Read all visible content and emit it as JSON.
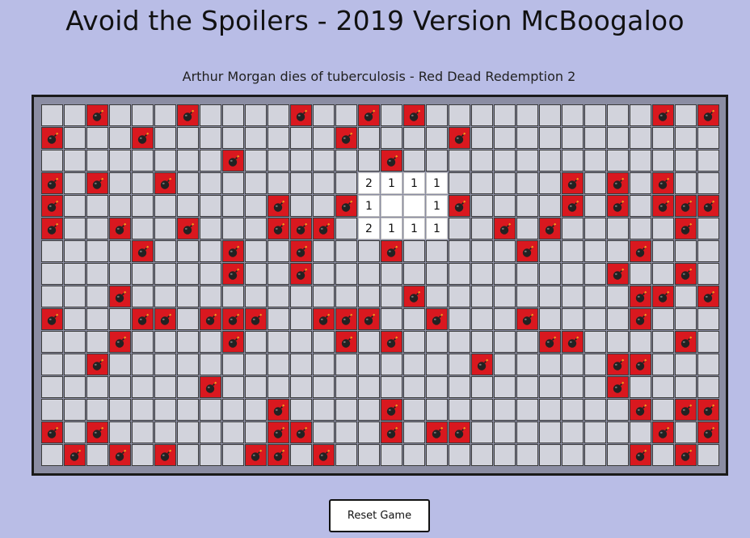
{
  "header": {
    "title": "Avoid the Spoilers - 2019 Version McBoogaloo",
    "subtitle": "Arthur Morgan dies of tuberculosis - Red Dead Redemption 2"
  },
  "board": {
    "cols": 30,
    "rows": 15,
    "legend": {
      "#": "mine (revealed bomb)",
      ".": "unopened",
      "_": "opened empty",
      "digit": "opened count"
    },
    "cells": [
      "..#....#....#...#.#..........#",
      "#.....#.......#.....#........#",
      "#.....#.........#.............",
      "#...#.#.............#.......#..",
      "#.#..#........2111......#.#.#.",
      "#..........#..#1__1#....#.#.###",
      "#...#..#....#.####......#.#....",
      "......#..#.#.2111..#.#.....#.#",
      "....#....#..#.....#..#.....#.#",
      ".........#..#..........#...#.#",
      "...#..............#.......##.#",
      "#...##.###..###...#...#....#..",
      "...#......#.....#.#.......##.#",
      "..#...................#.....#.#",
      "........#.................#...",
      "...........#.....#..........#.##",
      "#.#........##.....#.##.....#.#",
      ".#.#..#..##.#.......#......#.#"
    ]
  },
  "controls": {
    "reset_label": "Reset Game"
  }
}
